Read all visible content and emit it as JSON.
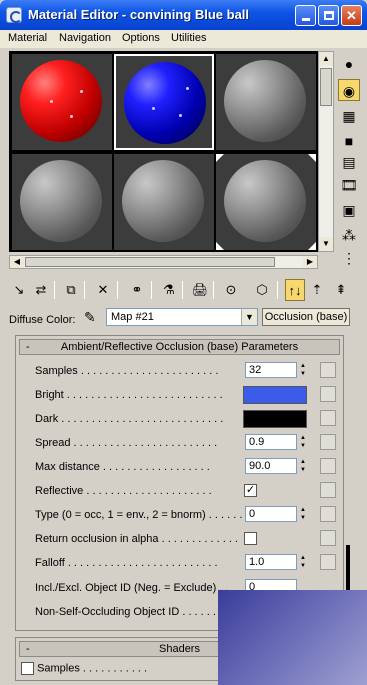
{
  "window": {
    "title": "Material Editor - convining Blue ball",
    "controls": [
      "minimize",
      "maximize",
      "close"
    ]
  },
  "menu": [
    "Material",
    "Navigation",
    "Options",
    "Utilities"
  ],
  "sample_slots": [
    {
      "color": "red",
      "active": false
    },
    {
      "color": "blue",
      "active": true
    },
    {
      "color": "grey",
      "active": false
    },
    {
      "color": "grey",
      "active": false
    },
    {
      "color": "grey",
      "active": false
    },
    {
      "color": "grey",
      "active": false
    }
  ],
  "diffuse": {
    "label": "Diffuse Color:",
    "map_name": "Map #21",
    "map_type": "Occlusion (base)"
  },
  "rollout": {
    "title": "Ambient/Reflective Occlusion (base) Parameters",
    "toggle": "-",
    "params": [
      {
        "label": "Samples",
        "kind": "spinner",
        "value": "32"
      },
      {
        "label": "Bright",
        "kind": "color",
        "color": "#3a5ce8"
      },
      {
        "label": "Dark",
        "kind": "color",
        "color": "#000000"
      },
      {
        "label": "Spread",
        "kind": "spinner",
        "value": "0.9"
      },
      {
        "label": "Max distance",
        "kind": "spinner",
        "value": "90.0"
      },
      {
        "label": "Reflective",
        "kind": "checkbox",
        "checked": true
      },
      {
        "label": "Type (0 = occ, 1 = env., 2 = bnorm)",
        "kind": "spinner",
        "value": "0"
      },
      {
        "label": "Return occlusion in alpha",
        "kind": "checkbox",
        "checked": false
      },
      {
        "label": "Falloff",
        "kind": "spinner",
        "value": "1.0"
      },
      {
        "label": "Incl./Excl. Object ID (Neg. = Exclude)",
        "kind": "spinner",
        "value": "0"
      },
      {
        "label": "Non-Self-Occluding Object ID",
        "kind": "spinner",
        "value": ""
      }
    ]
  },
  "shaders": {
    "title": "Shaders",
    "toggle": "-",
    "samples_label": "Samples"
  }
}
